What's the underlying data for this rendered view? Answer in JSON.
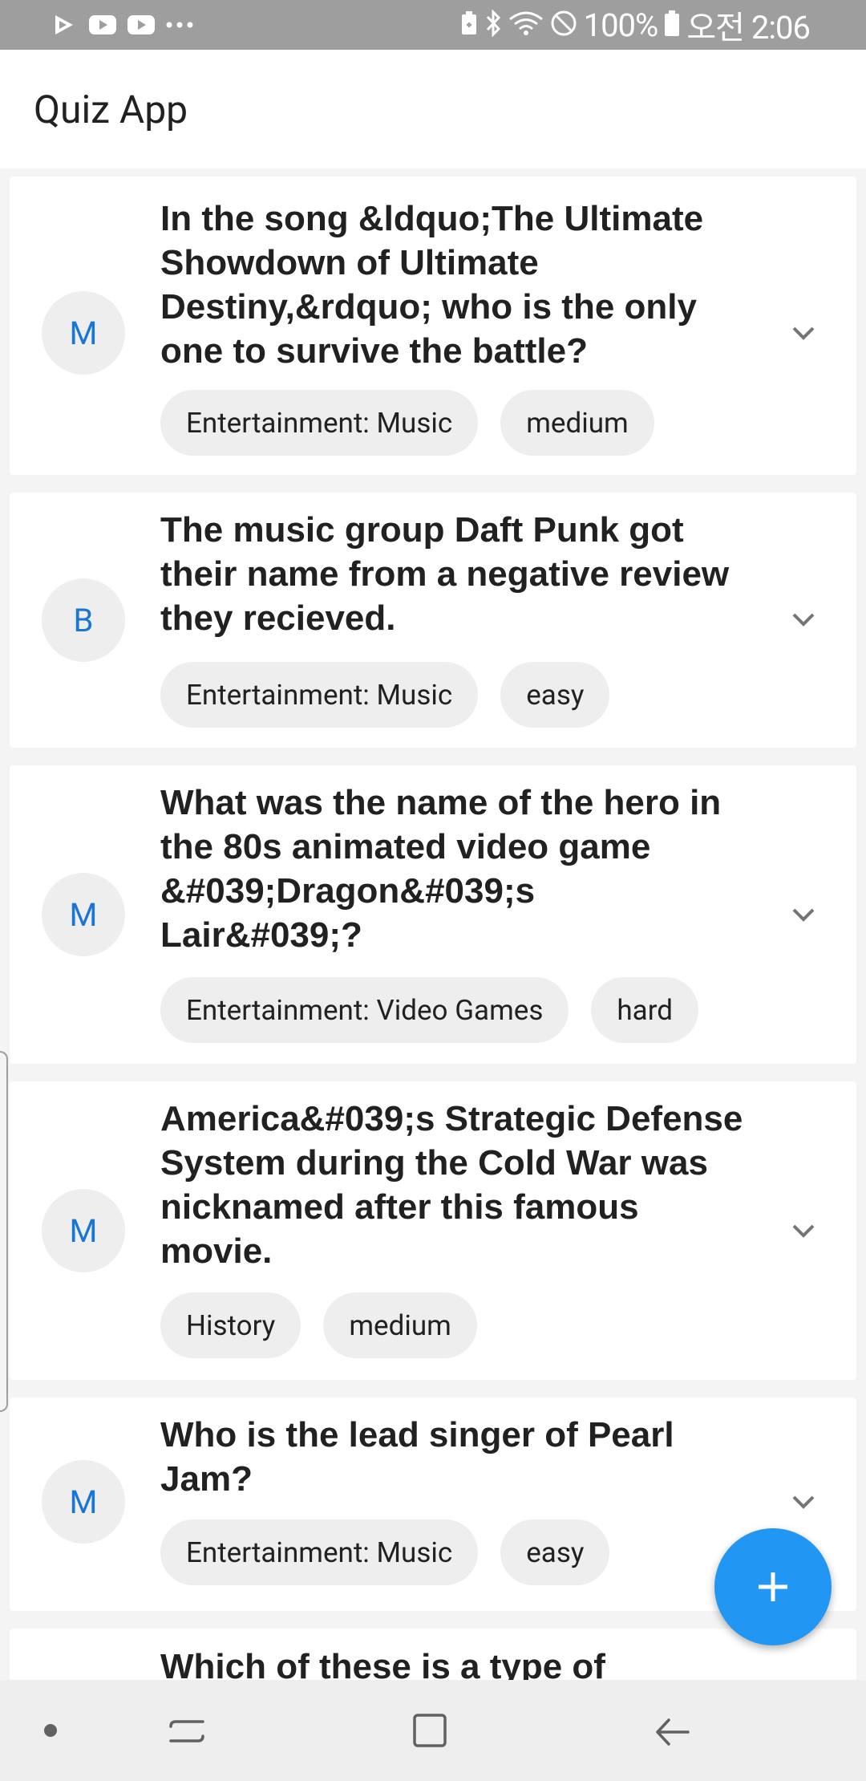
{
  "status_bar": {
    "left_icons": [
      "play-store-icon",
      "youtube-icon",
      "youtube-icon",
      "more-dots-icon"
    ],
    "right_icons": [
      "battery-saver-icon",
      "bluetooth-icon",
      "wifi-icon",
      "do-not-disturb-icon",
      "battery-icon"
    ],
    "battery": "100%",
    "time": "오전 2:06"
  },
  "app_bar": {
    "title": "Quiz App"
  },
  "questions": [
    {
      "avatar": "M",
      "text": "In the song &ldquo;The Ultimate Showdown of Ultimate Destiny,&rdquo; who is the only one to survive the battle?",
      "category": "Entertainment: Music",
      "difficulty": "medium"
    },
    {
      "avatar": "B",
      "text": "The music group Daft Punk got their name from a negative review they recieved.",
      "category": "Entertainment: Music",
      "difficulty": "easy"
    },
    {
      "avatar": "M",
      "text": "What was the name of the hero in the 80s animated video game &#039;Dragon&#039;s Lair&#039;?",
      "category": "Entertainment: Video Games",
      "difficulty": "hard"
    },
    {
      "avatar": "M",
      "text": "America&#039;s Strategic Defense System during the Cold War was nicknamed after this famous movie.",
      "category": "History",
      "difficulty": "medium"
    },
    {
      "avatar": "M",
      "text": "Who is the lead singer of Pearl Jam?",
      "category": "Entertainment: Music",
      "difficulty": "easy"
    },
    {
      "text": "Which of these is a type of"
    }
  ],
  "fab": {
    "icon": "plus-icon"
  },
  "nav_bar": {
    "icons": [
      "dot-icon",
      "recent-apps-icon",
      "home-icon",
      "back-icon"
    ]
  },
  "colors": {
    "accent": "#2196f3",
    "avatar_text": "#1976d2",
    "status_bar": "#9e9e9e",
    "chip_bg": "#eeeeee"
  }
}
